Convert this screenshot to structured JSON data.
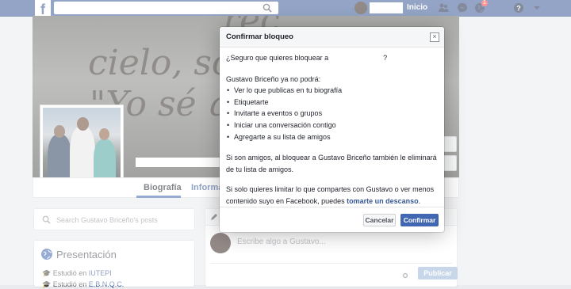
{
  "topbar": {
    "logo": "f",
    "search_placeholder": "",
    "home_label": "Inicio",
    "notifications_count": "1",
    "icons": [
      "search-icon",
      "friends-icon",
      "messenger-icon",
      "globe-icon",
      "help-icon",
      "chevron-down-icon"
    ]
  },
  "profile": {
    "tabs": [
      "Biografía",
      "Informac"
    ],
    "active_tab": "Biografía"
  },
  "left": {
    "search_placeholder": "Search Gustavo Briceño's posts",
    "intro_title": "Presentación",
    "intro_lines": [
      {
        "prefix": "Estudió en ",
        "link": "IUTEPI"
      },
      {
        "prefix": "Estudió en ",
        "link": "E.B.N.Q.C."
      }
    ]
  },
  "composer": {
    "placeholder": "Escribe algo a Gustavo...",
    "publish_label": "Publicar"
  },
  "dialog": {
    "title": "Confirmar bloqueo",
    "question_prefix": "¿Seguro que quieres bloquear a",
    "question_suffix": "?",
    "cannot_intro": "Gustavo Briceño ya no podrá:",
    "cannot_items": [
      "Ver lo que publicas en tu biografía",
      "Etiquetarte",
      "Invitarte a eventos o grupos",
      "Iniciar una conversación contigo",
      "Agregarte a su lista de amigos"
    ],
    "friends_note": "Si son amigos, al bloquear a Gustavo Briceño también le eliminará de tu lista de amigos.",
    "limit_note": "Si solo quieres limitar lo que compartes con Gustavo o ver menos contenido suyo en Facebook, puedes",
    "limit_link": "tomarte un descanso",
    "limit_end": ".",
    "cancel_label": "Cancelar",
    "confirm_label": "Confirmar"
  },
  "colors": {
    "brand": "#3b5998",
    "primary_button": "#4267b2",
    "link": "#385898",
    "badge": "#fa3e3e"
  }
}
